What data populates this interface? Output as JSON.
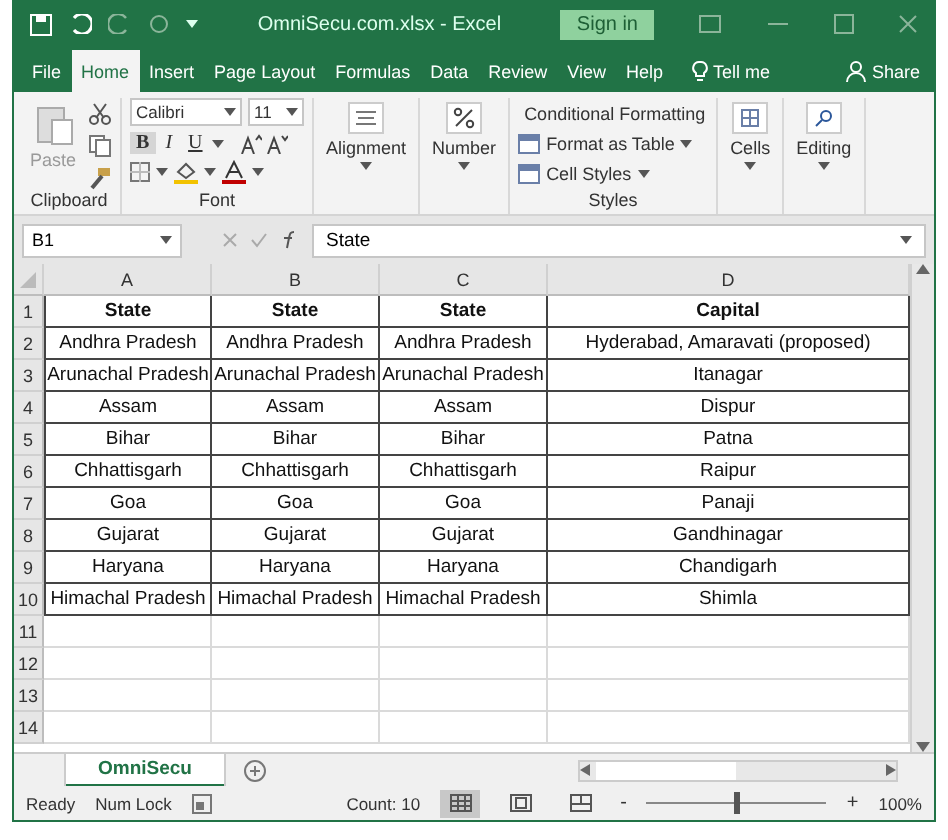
{
  "window": {
    "title": "OmniSecu.com.xlsx  -  Excel",
    "sign_in": "Sign in"
  },
  "tabs": [
    {
      "label": "File",
      "selected": false
    },
    {
      "label": "Home",
      "selected": true
    },
    {
      "label": "Insert",
      "selected": false
    },
    {
      "label": "Page Layout",
      "selected": false
    },
    {
      "label": "Formulas",
      "selected": false
    },
    {
      "label": "Data",
      "selected": false
    },
    {
      "label": "Review",
      "selected": false
    },
    {
      "label": "View",
      "selected": false
    },
    {
      "label": "Help",
      "selected": false
    }
  ],
  "tell_me": "Tell me",
  "share": "Share",
  "ribbon": {
    "paste": "Paste",
    "clipboard": "Clipboard",
    "font_name": "Calibri",
    "font_size": "11",
    "bold": "B",
    "italic": "I",
    "underline": "U",
    "font": "Font",
    "alignment": "Alignment",
    "number": "Number",
    "styles_items": [
      "Conditional Formatting",
      "Format as Table",
      "Cell Styles"
    ],
    "styles": "Styles",
    "cells": "Cells",
    "editing": "Editing"
  },
  "formula_bar": {
    "name_box": "B1",
    "value": "State"
  },
  "table": {
    "columns": [
      "A",
      "B",
      "C",
      "D"
    ],
    "rows": [
      {
        "number": "1",
        "cells": [
          "State",
          "State",
          "State",
          "Capital"
        ]
      },
      {
        "number": "2",
        "cells": [
          "Andhra Pradesh",
          "Andhra Pradesh",
          "Andhra Pradesh",
          "Hyderabad, Amaravati (proposed)"
        ]
      },
      {
        "number": "3",
        "cells": [
          "Arunachal Pradesh",
          "Arunachal Pradesh",
          "Arunachal Pradesh",
          "Itanagar"
        ]
      },
      {
        "number": "4",
        "cells": [
          "Assam",
          "Assam",
          "Assam",
          "Dispur"
        ]
      },
      {
        "number": "5",
        "cells": [
          "Bihar",
          "Bihar",
          "Bihar",
          "Patna"
        ]
      },
      {
        "number": "6",
        "cells": [
          "Chhattisgarh",
          "Chhattisgarh",
          "Chhattisgarh",
          "Raipur"
        ]
      },
      {
        "number": "7",
        "cells": [
          "Goa",
          "Goa",
          "Goa",
          "Panaji"
        ]
      },
      {
        "number": "8",
        "cells": [
          "Gujarat",
          "Gujarat",
          "Gujarat",
          "Gandhinagar"
        ]
      },
      {
        "number": "9",
        "cells": [
          "Haryana",
          "Haryana",
          "Haryana",
          "Chandigarh"
        ]
      },
      {
        "number": "10",
        "cells": [
          "Himachal Pradesh",
          "Himachal Pradesh",
          "Himachal Pradesh",
          "Shimla"
        ]
      },
      {
        "number": "11",
        "cells": []
      },
      {
        "number": "12",
        "cells": []
      },
      {
        "number": "13",
        "cells": []
      },
      {
        "number": "14",
        "cells": []
      }
    ]
  },
  "sheet_tabs": [
    {
      "label": "OmniSecu",
      "selected": true
    }
  ],
  "status_bar": {
    "ready": "Ready",
    "num_lock": "Num Lock",
    "count": "Count: 10",
    "views": [
      {
        "kind": "normal",
        "selected": true
      },
      {
        "kind": "page-layout",
        "selected": false
      },
      {
        "kind": "page-break",
        "selected": false
      }
    ],
    "zoom": {
      "level": 0.5,
      "minus": "-",
      "plus": "+",
      "reading": "100%"
    }
  }
}
